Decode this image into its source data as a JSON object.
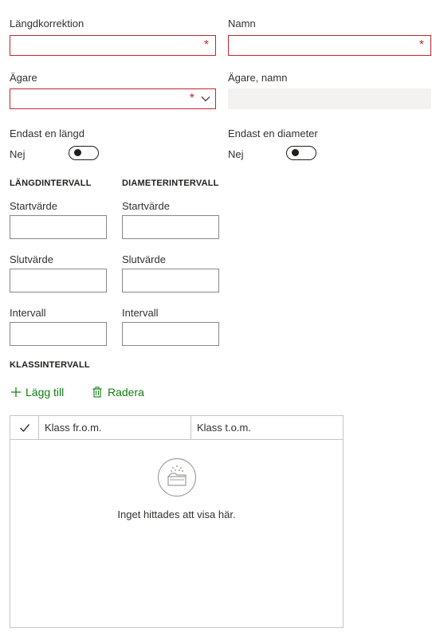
{
  "form": {
    "langdkorrektion": {
      "label": "Längdkorrektion",
      "value": "",
      "required_mark": "*"
    },
    "namn": {
      "label": "Namn",
      "value": "",
      "required_mark": "*"
    },
    "agare": {
      "label": "Ägare",
      "value": "",
      "required_mark": "*"
    },
    "agare_namn": {
      "label": "Ägare, namn",
      "value": ""
    },
    "endast_langd": {
      "label": "Endast en längd",
      "state_text": "Nej",
      "on": false
    },
    "endast_diameter": {
      "label": "Endast en diameter",
      "state_text": "Nej",
      "on": false
    }
  },
  "langdintervall": {
    "heading": "LÄNGDINTERVALL",
    "start_label": "Startvärde",
    "start_value": "",
    "slut_label": "Slutvärde",
    "slut_value": "",
    "intervall_label": "Intervall",
    "intervall_value": ""
  },
  "diameterintervall": {
    "heading": "DIAMETERINTERVALL",
    "start_label": "Startvärde",
    "start_value": "",
    "slut_label": "Slutvärde",
    "slut_value": "",
    "intervall_label": "Intervall",
    "intervall_value": ""
  },
  "klassintervall": {
    "heading": "KLASSINTERVALL",
    "add_label": "Lägg till",
    "delete_label": "Radera",
    "columns": [
      "Klass fr.o.m.",
      "Klass t.o.m."
    ],
    "rows": [],
    "empty_text": "Inget hittades att visa här."
  },
  "colors": {
    "required": "#c4262e",
    "command": "#107c10",
    "border": "#8a8886",
    "disabled": "#f3f2f1"
  },
  "icons": {
    "add": "plus-icon",
    "delete": "trash-icon",
    "check": "checkmark-icon",
    "chevron": "chevron-down-icon",
    "empty": "empty-folder-icon"
  }
}
